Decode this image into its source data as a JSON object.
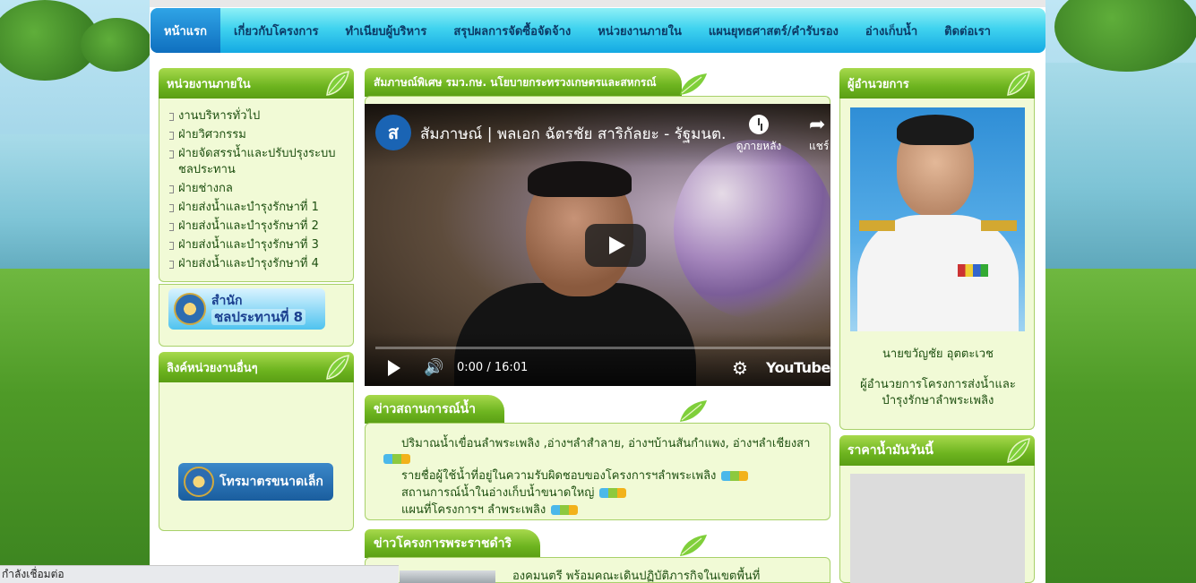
{
  "nav": {
    "items": [
      {
        "label": "หน้าแรก",
        "active": true
      },
      {
        "label": "เกี่ยวกับโครงการ"
      },
      {
        "label": "ทำเนียบผู้บริหาร"
      },
      {
        "label": "สรุปผลการจัดซื้อจัดจ้าง"
      },
      {
        "label": "หน่วยงานภายใน"
      },
      {
        "label": "แผนยุทธศาสตร์/คำรับรอง"
      },
      {
        "label": "อ่างเก็บน้ำ"
      },
      {
        "label": "ติดต่อเรา"
      }
    ]
  },
  "internal": {
    "title": "หน่วยงานภายใน",
    "items": [
      "งานบริหารทั่วไป",
      "ฝ่ายวิศวกรรม",
      "ฝ่ายจัดสรรน้ำและปรับปรุงระบบชลประทาน",
      "ฝ่ายช่างกล",
      "ฝ่ายส่งน้ำและบำรุงรักษาที่ 1",
      "ฝ่ายส่งน้ำและบำรุงรักษาที่ 2",
      "ฝ่ายส่งน้ำและบำรุงรักษาที่ 3",
      "ฝ่ายส่งน้ำและบำรุงรักษาที่ 4"
    ],
    "banner": {
      "line1": "สำนัก",
      "line2": "ชลประทานที่  8"
    }
  },
  "links": {
    "title": "ลิงค์หน่วยงานอื่นๆ",
    "banner": "โทรมาตรขนาดเล็ก"
  },
  "interview": {
    "title": "สัมภาษณ์พิเศษ รมว.กษ. นโยบายกระทรวงเกษตรและสหกรณ์",
    "video_title": "สัมภาษณ์ | พลเอก ฉัตรชัย สาริกัลยะ - รัฐมนต...",
    "watch_later": "ดูภายหลัง",
    "share": "แชร์",
    "time": "0:00 / 16:01",
    "brand": "YouTube"
  },
  "water_news": {
    "title": "ข่าวสถานการณ์น้ำ",
    "items": [
      "ปริมาณน้ำเขื่อนลำพระเพลิง ,อ่างฯลำสำลาย, อ่างฯบ้านสันกำแพง, อ่างฯลำเชียงสา",
      "รายชื่อผู้ใช้น้ำที่อยู่ในความรับผิดชอบของโครงการฯลำพระเพลิง",
      "สถานการณ์น้ำในอ่างเก็บน้ำขนาดใหญ่",
      "แผนที่โครงการฯ ลำพระเพลิง"
    ]
  },
  "royal_news": {
    "title": "ข่าวโครงการพระราชดำริ",
    "item": "องคมนตรี พร้อมคณะเดินปฏิบัติภารกิจในเขตพื้นที่"
  },
  "director": {
    "title": "ผู้อำนวยการ",
    "name": "นายขวัญชัย อุตตะเวช",
    "position": "ผู้อำนวยการโครงการส่งน้ำและบำรุงรักษาลำพระเพลิง"
  },
  "oil": {
    "title": "ราคาน้ำมันวันนี้"
  },
  "status_bar": "กำลังเชื่อมต่อ",
  "colors": {
    "nav_top": "#8ef0f6",
    "nav_bottom": "#14a9e3",
    "box_green": "#6db41f",
    "box_bg": "#f1fad6"
  }
}
